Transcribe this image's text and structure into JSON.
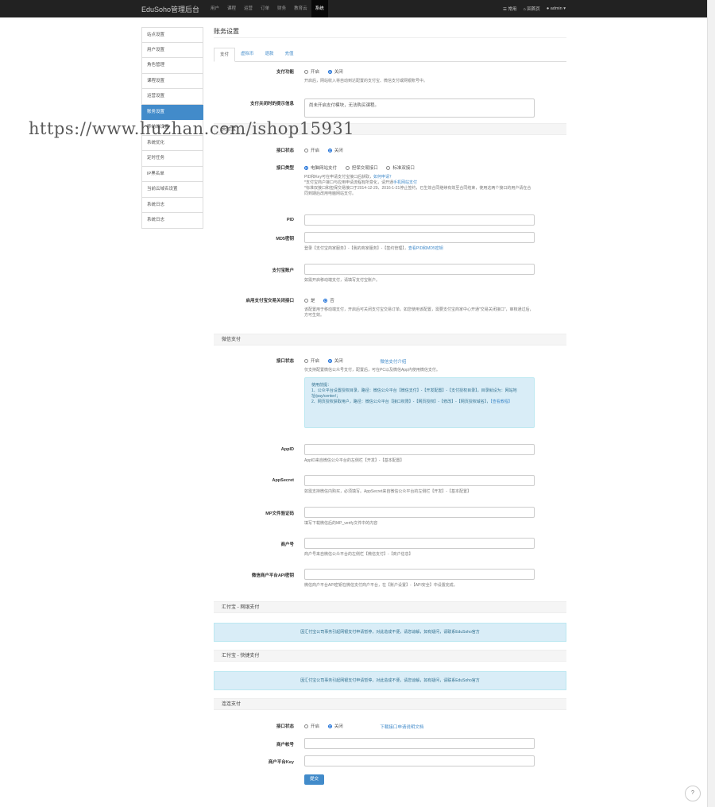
{
  "navbar": {
    "brand": "EduSoho管理后台",
    "items": [
      "用户",
      "课程",
      "运营",
      "订单",
      "财务",
      "教育云",
      "系统"
    ],
    "active_index": 6,
    "right": {
      "common": "常用",
      "home": "回首页",
      "user": "admin"
    }
  },
  "sidebar": {
    "items": [
      "站点设置",
      "用户设置",
      "角色管理",
      "课程设置",
      "运营设置",
      "账务设置",
      "移动端设置",
      "系统优化",
      "定时任务",
      "IP黑名单",
      "当前云域名设置",
      "系统日志",
      "系统日志"
    ],
    "active_index": 5
  },
  "page": {
    "title": "账务设置",
    "tabs": [
      "支付",
      "虚拟币",
      "退款",
      "充值"
    ],
    "active_tab": 0
  },
  "payment": {
    "label": "支付功能",
    "opt_on": "开启",
    "opt_off": "关闭",
    "help": "开启后，网站收入将自动到达配置的支付宝、微信支付或网银账号中。",
    "closed_notice_label": "支付关闭时的提示信息",
    "closed_notice_value": "尚未开启支付模块，无法购买课程。"
  },
  "alipay": {
    "section": "支付宝",
    "status_label": "接口状态",
    "type_label": "接口类型",
    "type_options": [
      "电脑网站支付",
      "担保交易接口",
      "标准双接口"
    ],
    "type_help1": "PID和Key可在申请支付宝接口后获取，",
    "type_help1_link": "如何申请？",
    "type_help2": "*支付宝商户接口与应用申请流程有所变化，请开通",
    "type_help2_link": "手机网站支付",
    "type_help3": "*标准双接口和担保交易接口于2014-12-29、2016-1-21停止签约，已生效合同继续有效至合同结束，使用这两个接口的用户请在合同到期后改用电脑网站支付。",
    "pid_label": "PID",
    "md5_label": "MD5密钥",
    "md5_help": "登录【支付宝商家服务】-【我的商家服务】-【签约管理】，",
    "md5_help_link": "查看PID和MD5密钥",
    "account_label": "支付宝账户",
    "account_help": "如需开启移动端支付，请填写支付宝账户。",
    "close_api_label": "启用支付宝交易关闭接口",
    "close_opt_yes": "是",
    "close_opt_no": "否",
    "close_help": "该配置用于移动端支付，开启后可关闭支付宝交易订单。如您使用该配置，需要支付宝商家中心开通\"交易关闭接口\"，审核通过后，方可生效。"
  },
  "wechat": {
    "section": "微信支付",
    "status_label": "接口状态",
    "doc_link": "微信支付介绍",
    "help": "仅支持配置微信公众号支付，配置后，可在PC以及微信App内使用微信支付。",
    "info_title": "使用前提：",
    "info_line1": "1、公众平台设置授权目录，路径：微信公众平台【微信支付】-【开发配置】-【支付授权目录】，目录就设为：网站地址/pay/center/；",
    "info_line2": "2、网页授权获取用户，路径：微信公众平台【接口权限】-【网页授权】-【修改】-【网页授权域名】，",
    "info_line2_link": "【查看教程】",
    "appid_label": "AppID",
    "appid_help": "AppID来自微信公众平台的左侧栏【开发】-【基本配置】",
    "secret_label": "AppSecret",
    "secret_help": "如需支持微信内购买，必须填写。AppSecret来自微信公众平台的左侧栏【开发】-【基本配置】",
    "mp_label": "MP文件验证码",
    "mp_help": "填写下载微信后的MP_verify文件中的内容",
    "mch_label": "商户号",
    "mch_help": "商户号来自微信公众平台的左侧栏【微信支付】-【商户信息】",
    "key_label": "微信商户平台API密钥",
    "key_help": "微信商户平台API密钥在微信支付商户平台，在【账户设置】-【API安全】中设置完成。"
  },
  "heepay": {
    "section": "汇付宝 - 网银支付",
    "alert": "因汇付宝公司事务引起网银支付申请暂停，对此造成不便，请您谅解，如有疑问，请联系EduSoho官方"
  },
  "heepay_quick": {
    "section": "汇付宝 - 快捷支付",
    "alert": "因汇付宝公司事务引起网银支付申请暂停，对此造成不便，请您谅解，如有疑问，请联系EduSoho官方"
  },
  "llpay": {
    "section": "连连支付",
    "status_label": "接口状态",
    "doc_link": "下载接口申请说明文档",
    "account_label": "商户帐号",
    "key_label": "商户平台Key",
    "submit": "提交"
  },
  "watermark": "https://www.huzhan.com/ishop15931",
  "help_icon": "?"
}
